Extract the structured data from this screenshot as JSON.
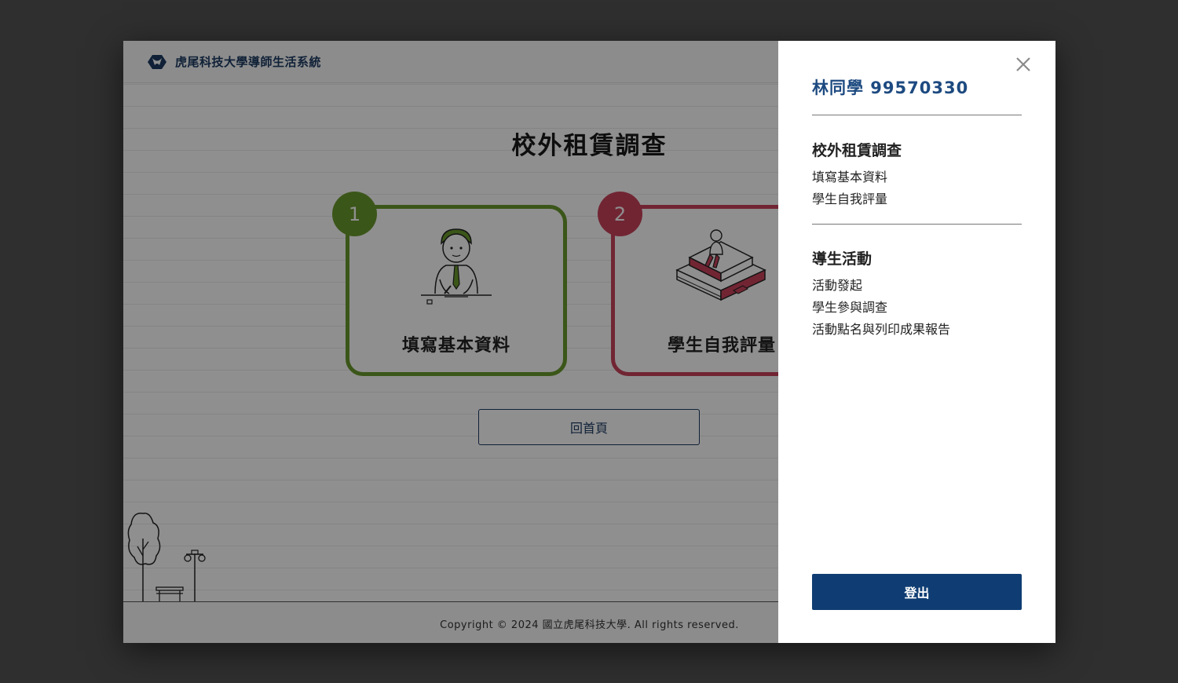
{
  "header": {
    "site_title": "虎尾科技大學導師生活系統",
    "logo_icon": "university-logo-icon"
  },
  "main": {
    "title": "校外租賃調查",
    "cards": [
      {
        "number": "1",
        "label": "填寫基本資料",
        "color": "#6a9a2e",
        "illustration": "student-writing-icon"
      },
      {
        "number": "2",
        "label": "學生自我評量",
        "color": "#c9435c",
        "illustration": "student-sitting-icon"
      }
    ],
    "home_button": "回首頁"
  },
  "footer": {
    "copyright": "Copyright © 2024 國立虎尾科技大學. All rights reserved."
  },
  "drawer": {
    "close_icon": "close-icon",
    "user": "林同學 99570330",
    "sections": [
      {
        "title": "校外租賃調查",
        "items": [
          "填寫基本資料",
          "學生自我評量"
        ]
      },
      {
        "title": "導生活動",
        "items": [
          "活動發起",
          "學生參與調查",
          "活動點名與列印成果報告"
        ]
      }
    ],
    "logout": "登出"
  },
  "colors": {
    "brand": "#0f3d73",
    "green": "#6a9a2e",
    "red": "#c9435c",
    "overlay": "rgba(0,0,0,0.44)"
  }
}
